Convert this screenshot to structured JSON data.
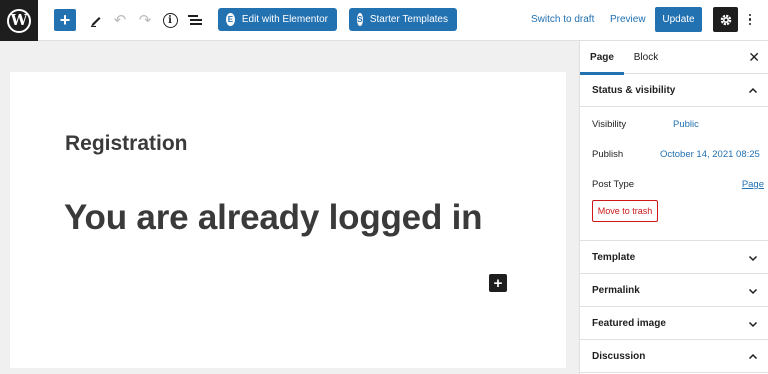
{
  "toolbar": {
    "add_icon": "plus-icon",
    "edit_icon": "pencil-icon",
    "undo_icon": "undo-icon",
    "redo_icon": "redo-icon",
    "info_icon": "info-icon",
    "outline_icon": "list-view-icon",
    "elementor_label": "Edit with Elementor",
    "starter_label": "Starter Templates",
    "switch_draft_label": "Switch to draft",
    "preview_label": "Preview",
    "update_label": "Update",
    "settings_icon": "gear-icon",
    "more_icon": "more-vertical-icon"
  },
  "editor": {
    "registration_title": "Registration",
    "heading": "You are already logged in"
  },
  "sidebar": {
    "tabs": [
      {
        "label": "Page",
        "active": true
      },
      {
        "label": "Block",
        "active": false
      }
    ],
    "close_label": "✕",
    "status": {
      "title": "Status & visibility",
      "visibility_label": "Visibility",
      "visibility_value": "Public",
      "publish_label": "Publish",
      "publish_value": "October 14, 2021 08:25",
      "post_type_label": "Post Type",
      "post_type_value": "Page",
      "trash_label": "Move to trash"
    },
    "panels": [
      {
        "title": "Template",
        "expanded": false
      },
      {
        "title": "Permalink",
        "expanded": false
      },
      {
        "title": "Featured image",
        "expanded": false
      },
      {
        "title": "Discussion",
        "expanded": true
      }
    ]
  },
  "colors": {
    "accent": "#2271b1",
    "dark": "#1e1e1e",
    "danger": "#cc1818",
    "editor_bg": "#f0f0f0"
  }
}
